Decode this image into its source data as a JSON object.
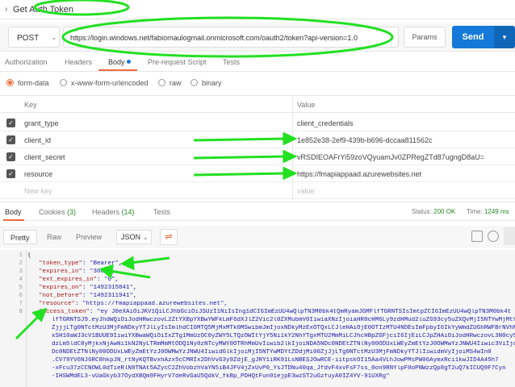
{
  "title": "Get Auth Token",
  "request": {
    "method": "POST",
    "url": "https://login.windows.net/fabiomaulogmail.onmicrosoft.com/oauth2/token?api-version=1.0",
    "params_label": "Params",
    "send_label": "Send"
  },
  "req_tabs": [
    "Authorization",
    "Headers",
    "Body",
    "Pre-request Script",
    "Tests"
  ],
  "body_types": [
    "form-data",
    "x-www-form-urlencoded",
    "raw",
    "binary"
  ],
  "kv": {
    "key_header": "Key",
    "value_header": "Value",
    "rows": [
      {
        "key": "grant_type",
        "value": "client_credentials"
      },
      {
        "key": "client_id",
        "value": "1e852e38-2ef9-439b-b696-dccaa811562c"
      },
      {
        "key": "client_secret",
        "value": "vRSDIEOAFrYi59zoVQyuamJv0ZPRegZTd87ugngD8aU="
      },
      {
        "key": "resource",
        "value": "https://fmapiappaad.azurewebsites.net"
      }
    ],
    "new_key": "New key",
    "new_value": "value"
  },
  "resp_tabs": {
    "body": "Body",
    "cookies": "Cookies",
    "cookies_count": "(3)",
    "headers": "Headers",
    "headers_count": "(14)",
    "tests": "Tests"
  },
  "status": {
    "status_label": "Status:",
    "status_value": "200 OK",
    "time_label": "Time:",
    "time_value": "1249 ms"
  },
  "view_modes": [
    "Pretty",
    "Raw",
    "Preview"
  ],
  "format": "JSON",
  "code_lines": [
    {
      "n": "1",
      "text": "{"
    },
    {
      "n": "2",
      "key": "\"token_type\"",
      "val": ": \"Bearer\","
    },
    {
      "n": "3",
      "key": "\"expires_in\"",
      "val": ": \"3600\","
    },
    {
      "n": "4",
      "key": "\"ext_expires_in\"",
      "val": ": \"0\","
    },
    {
      "n": "5",
      "key": "\"expires_on\"",
      "val": ": \"1492315841\","
    },
    {
      "n": "6",
      "key": "\"not_before\"",
      "val": ": \"1492311941\","
    },
    {
      "n": "7",
      "key": "\"resource\"",
      "val": ": \"https://fmapiappaad.azurewebsites.net\","
    },
    {
      "n": "8",
      "key": "\"access_token\"",
      "val": ": \"ey J0eXAiOiJKV1QiLCJhbGciOiJSUzI1NiIsIng1dCI6ImEzUU4wQlpTN3M0bk4tQmRyamJGMFlfTGRNTSIsImtpZCI6ImEzUU4wQlpTN3M0bk4t"
    }
  ],
  "token_continuation": [
    "lfTGRNTSJ9.eyJhdWQiOiJodHRwczovL2ZtYXBpYXBwYWFkLmF6dXJlZ2Vic2l0ZXMubmV0IiwiaXNzIjoiaHR0cHM6Ly9zdHMud2luZG93cy5uZXQvMjI5NTYwMjMtY",
    "ZjjjLTg0NTctMzU3MjFmNDkyYTJlLyIsImlhdCI6MTQ5MjMxMTk0MSwibmJmIjoxNDkyMzExOTQxLCJleHAiOjE0OTIzMTU4NDEsImFpbyI6IkYyWmdZUGhRWFBrNVhN",
    "xSH10aWJ3cV1BUUE9IiwiYXBwaWQiOiIxZTg1MmUzOC0yZWY5LTQzOWItYjY5Ni1kY2NhYTgxMTU2MmMiLCJhcHBpZGFjciI6IjEiLCJpZHAiOiJodHRwczovL3N0cy53",
    "dzLm5ldC8yMjkxNjAwNi1kN2NyLTRmMmMtODQ1Ny0zNTcyMWY0OTRhMmUvIiwib2lkIjoiNDA5NDc0NDEtZTNlNy00ODUxLWEyZmEtYzJ0OWMwYzJNWU4Iiwic3ViIjoi",
    "Dc0NDEtZTNlNy00ODUxLWEyZmEtYzJ0OWMwYzJNWU4IiwidGlkIjoiMjI5NTYwMDYtZDdjMi00ZjJjLTg0NTctMzU3MjFmNDkyYTJlIiwidmVyIjoiMS4wIn0",
    ".CV79YV6NJ6RC8hkpJN_rtNyKQTBvxhAzx5cCMRIx2DhVvG3y9ZdjE_gJRY1iRK91LsNBESJOwRCE-iitpskOI15Aa4VLhJowPMsPW06AymxRci1kwJID4A45h7",
    "-xFcu37zCCNOWL0dTieRlN8TNAt5AZycC2ZhVobzhVaYN5iB4JFV4jZxUvP0_YsJTDNu40qa_JfdvF4xvFsF7ss_0on9RNYlpF0oPNWzzQp8gT2uQ7kICUQ9F7Cyn",
    "-IHSWMdEL3-vUaGkyb37OydXBQm9FHyrV7deRvGaU5QdkV_fkBp_PDHQtFun01ejpE3wzST2uGzfuyA0IZ4YV-91UXRg\""
  ]
}
